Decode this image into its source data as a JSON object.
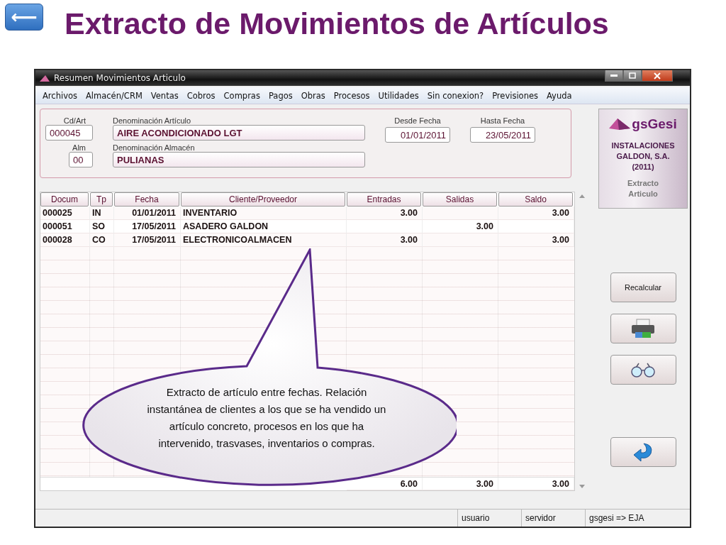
{
  "back_button": {
    "label": "⟵"
  },
  "title": "Extracto de Movimientos de Artículos",
  "window": {
    "title": "Resumen Movimientos Articulo",
    "menu": [
      "Archivos",
      "Almacén/CRM",
      "Ventas",
      "Cobros",
      "Compras",
      "Pagos",
      "Obras",
      "Procesos",
      "Utilidades",
      "Sin conexion?",
      "Previsiones",
      "Ayuda"
    ],
    "form": {
      "article_code": {
        "label": "Cd/Art",
        "value": "000045"
      },
      "article_name": {
        "label": "Denominación Artículo",
        "value": "AIRE ACONDICIONADO LGT"
      },
      "warehouse_code": {
        "label": "Alm",
        "value": "00"
      },
      "warehouse_name": {
        "label": "Denominación Almacén",
        "value": "PULIANAS"
      },
      "date_from": {
        "label": "Desde Fecha",
        "value": "01/01/2011"
      },
      "date_to": {
        "label": "Hasta Fecha",
        "value": "23/05/2011"
      }
    },
    "logo": {
      "brand": "gsGesi",
      "company_lines": [
        "INSTALACIONES",
        "GALDON, S.A.",
        "(2011)"
      ],
      "subtitle_lines": [
        "Extracto",
        "Articulo"
      ]
    },
    "table": {
      "columns": [
        "Docum",
        "Tp",
        "Fecha",
        "Cliente/Proveedor",
        "Entradas",
        "Salidas",
        "Saldo"
      ],
      "rows": [
        [
          "000025",
          "IN",
          "01/01/2011",
          "INVENTARIO",
          "3.00",
          "",
          "3.00"
        ],
        [
          "000051",
          "SO",
          "17/05/2011",
          "ASADERO GALDON",
          "",
          "3.00",
          ""
        ],
        [
          "000028",
          "CO",
          "17/05/2011",
          "ELECTRONICOALMACEN",
          "3.00",
          "",
          "3.00"
        ]
      ],
      "totals": [
        "6.00",
        "3.00",
        "3.00"
      ]
    },
    "buttons": [
      {
        "kind": "text",
        "label": "Recalcular"
      },
      {
        "kind": "print"
      },
      {
        "kind": "view"
      },
      {
        "kind": "return"
      }
    ],
    "status_bar": [
      "usuario",
      "servidor",
      "gsgesi => EJA"
    ]
  },
  "callout": {
    "text": "Extracto de artículo entre fechas. Relación instantánea de clientes  a los que se ha vendido un artículo concreto, procesos en los que ha intervenido, trasvases, inventarios o compras."
  }
}
